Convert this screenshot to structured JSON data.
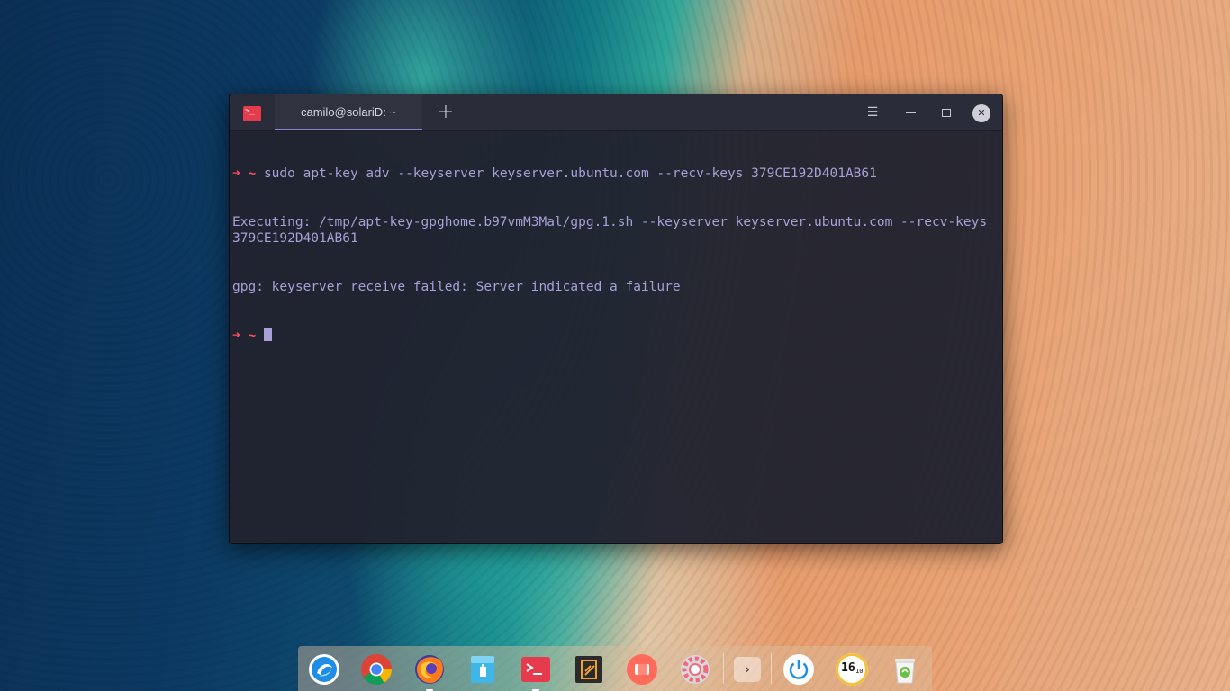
{
  "window": {
    "tab_title": "camilo@solariD: ~",
    "app_icon_glyph": ">_",
    "new_tab_glyph": "+",
    "menu_glyph": "☰",
    "close_glyph": "✕"
  },
  "terminal": {
    "prompt_arrow": "➜",
    "prompt_dir": "~",
    "command": "sudo apt-key adv --keyserver keyserver.ubuntu.com --recv-keys 379CE192D401AB61",
    "output_lines": [
      "Executing: /tmp/apt-key-gpghome.b97vmM3Mal/gpg.1.sh --keyserver keyserver.ubuntu.com --recv-keys 379CE192D401AB61",
      "gpg: keyserver receive failed: Server indicated a failure"
    ]
  },
  "dock": {
    "items": [
      {
        "name": "launcher-icon"
      },
      {
        "name": "chrome-icon"
      },
      {
        "name": "firefox-icon"
      },
      {
        "name": "file-manager-icon"
      },
      {
        "name": "terminal-icon"
      },
      {
        "name": "code-editor-icon"
      },
      {
        "name": "screen-recorder-icon"
      },
      {
        "name": "settings-icon"
      },
      {
        "name": "expand-tray-icon",
        "glyph": "›"
      },
      {
        "name": "power-icon"
      },
      {
        "name": "clock-icon",
        "hour": "16",
        "minute": "10"
      },
      {
        "name": "trash-icon"
      }
    ]
  },
  "colors": {
    "accent": "#8c82d8",
    "prompt": "#ff4d5e",
    "text": "#a79fd6",
    "terminal_bg": "#212330"
  }
}
